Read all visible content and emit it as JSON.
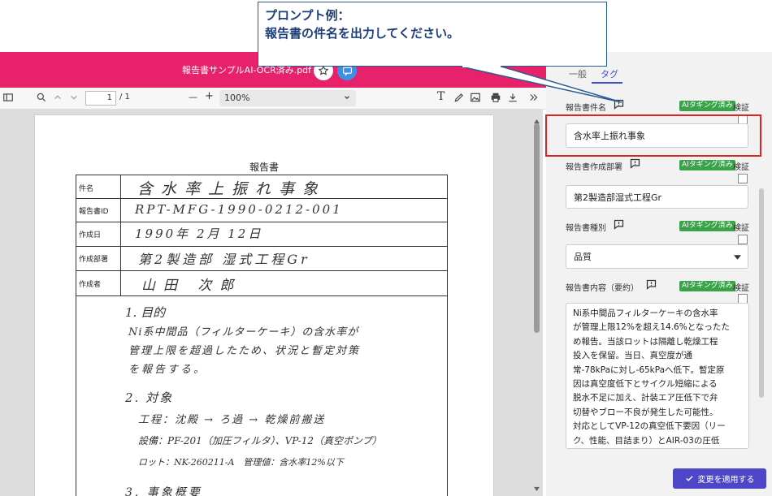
{
  "callout": {
    "line1": "プロンプト例：",
    "line2": "報告書の件名を出力してください。"
  },
  "viewer": {
    "file_title": "報告書サンプルAI-OCR済み.pdf",
    "page_current": "1",
    "page_total": "/ 1",
    "zoom": "100%",
    "zoom_minus": "—",
    "zoom_plus": "+"
  },
  "document": {
    "title": "報告書",
    "rows": [
      {
        "label": "件名",
        "value": "含水率上振れ事象"
      },
      {
        "label": "報告書ID",
        "value": "RPT-MFG-1990-0212-001"
      },
      {
        "label": "作成日",
        "value": "1990年 2月 12日"
      },
      {
        "label": "作成部署",
        "value": "第2製造部 湿式工程Gr"
      },
      {
        "label": "作成者",
        "value": "山田 次郎"
      }
    ],
    "body_lines": [
      "1. 目的",
      "Ni系中間品（フィルターケーキ）の含水率が",
      "管理上限を超過したため、状況と暫定対策",
      "を報告する。",
      "2. 対象",
      "工程：沈殿 → ろ過 → 乾燥前搬送",
      "設備：PF-201（加圧フィルタ）、VP-12（真空ポンプ）",
      "ロット：NK-260211-A　管理値：含水率12%以下",
      "3. 事象概要"
    ]
  },
  "panel": {
    "tabs": {
      "basic": "一般",
      "tags": "タグ"
    },
    "ai_badge": "AIタギング済み",
    "verify": "検証",
    "fields": {
      "subject": {
        "label": "報告書件名",
        "value": "含水率上振れ事象"
      },
      "dept": {
        "label": "報告書作成部署",
        "value": "第2製造部湿式工程Gr"
      },
      "type": {
        "label": "報告書種別",
        "value": "品質"
      },
      "content": {
        "label": "報告書内容（要約）",
        "lines": [
          "Ni系中間品フィルターケーキの含水率",
          "が管理上限12%を超え14.6%となったた",
          "め報告。当該ロットは隔離し乾燥工程",
          "投入を保留。当日、真空度が通",
          "常-78kPaに対し-65kPaへ低下。暫定原",
          "因は真空度低下とサイクル短縮による",
          "脱水不足に加え、計装エア圧低下で弁",
          "切替やブロー不良が発生した可能性。",
          "対応としてVP-12の真空低下要因（リー",
          "ク、性能、目詰まり）とAIR-03の圧低"
        ]
      }
    },
    "apply_button": "変更を適用する"
  },
  "colors": {
    "brand_pink": "#e8226a",
    "ai_green": "#3aa34a",
    "primary": "#4e46c9",
    "highlight_red": "#e0231f"
  }
}
